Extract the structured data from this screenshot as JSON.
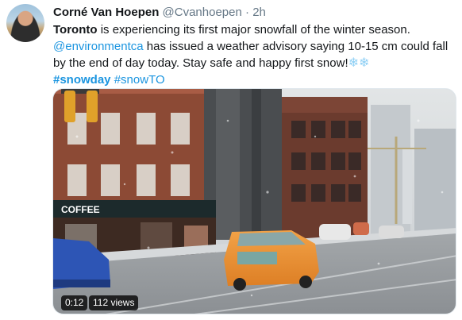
{
  "tweet": {
    "author_name": "Corné Van Hoepen",
    "author_handle": "@Cvanhoepen",
    "separator": "·",
    "time_ago": "2h",
    "text_line1_bold": "Toronto",
    "text_line1_rest": " is experiencing its first major snowfall of the winter season.",
    "mention": "@environmentca",
    "text_line2_rest": " has issued a weather advisory saying 10-15 cm could fall",
    "text_line3": "by the end of day today. Stay safe and happy first snow!",
    "snowflake_emoji": "❄❄",
    "hashtag1": "#snowday",
    "hashtag2": "#snowTO"
  },
  "video": {
    "duration": "0:12",
    "views": "112 views",
    "storefront_sign": "COFFEE"
  },
  "colors": {
    "link": "#1b95e0",
    "text": "#14171a",
    "muted": "#657786"
  }
}
